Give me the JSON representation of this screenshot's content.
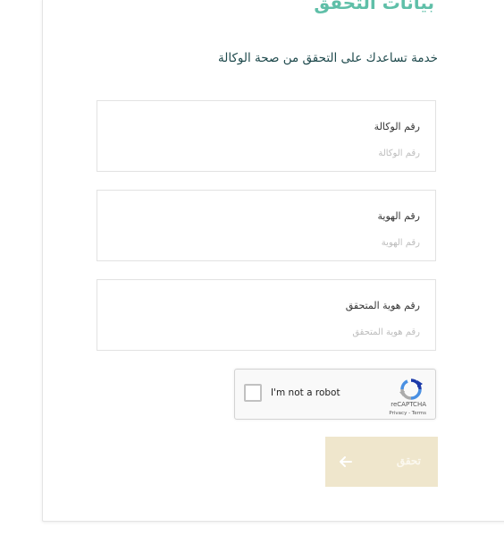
{
  "page": {
    "title": "بيانات التحقق",
    "subtitle": "خدمة تساعدك على التحقق من صحة الوكالة"
  },
  "fields": [
    {
      "label": "رقم الوكالة",
      "placeholder": "رقم الوكالة",
      "value": ""
    },
    {
      "label": "رقم الهوية",
      "placeholder": "رقم الهوية",
      "value": ""
    },
    {
      "label": "رقم هوية المتحقق",
      "placeholder": "رقم هوية المتحقق",
      "value": ""
    }
  ],
  "captcha": {
    "checkbox_label": "I'm not a robot",
    "brand": "reCAPTCHA",
    "links": "Privacy - Terms",
    "checked": false
  },
  "submit": {
    "label": "تحقق",
    "icon": "arrow-left-icon",
    "enabled": false
  },
  "colors": {
    "accent": "#5fbfa8",
    "heading": "#1f4a4d",
    "button_disabled": "#efe6cc",
    "border": "#e2e2e2"
  }
}
